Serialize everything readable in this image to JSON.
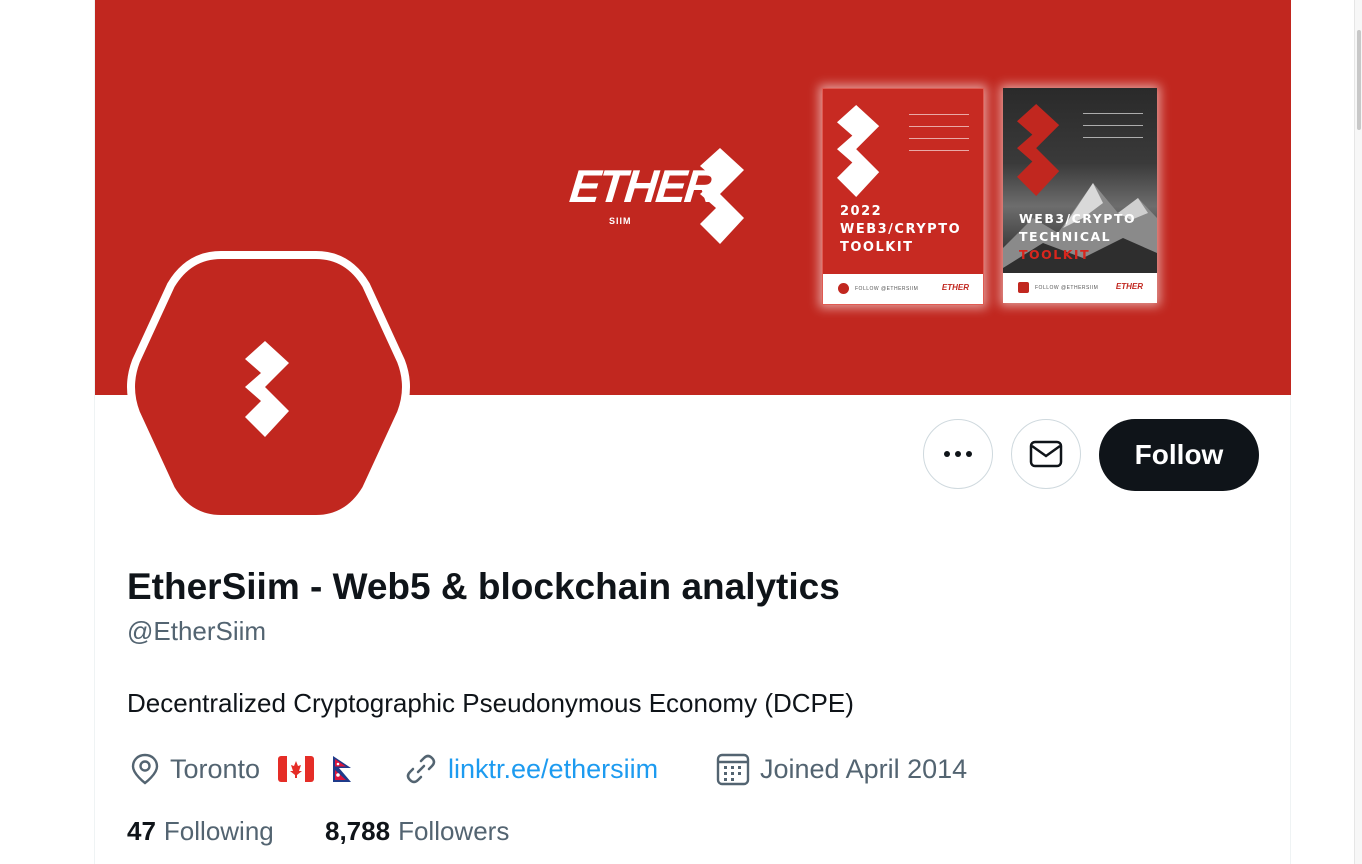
{
  "banner": {
    "brand_word": "ETHER",
    "brand_sub": "SIIM",
    "book1": {
      "title_lines": [
        "2022",
        "WEB3/CRYPTO",
        "TOOLKIT"
      ],
      "footer": "FOLLOW @ETHERSIIM",
      "footer_brand": "ETHER"
    },
    "book2": {
      "title_lines": [
        "WEB3/CRYPTO",
        "TECHNICAL"
      ],
      "title_accent": "TOOLKIT",
      "footer": "FOLLOW @ETHERSIIM",
      "footer_brand": "ETHER"
    }
  },
  "actions": {
    "more_icon": "ellipsis-icon",
    "message_icon": "envelope-icon",
    "follow_label": "Follow"
  },
  "profile": {
    "display_name": "EtherSiim - Web5 & blockchain analytics",
    "handle": "@EtherSiim",
    "bio": "Decentralized Cryptographic Pseudonymous Economy (DCPE)",
    "location": "Toronto",
    "flags": [
      "canada-flag",
      "nepal-flag"
    ],
    "website": "linktr.ee/ethersiim",
    "joined": "Joined April 2014"
  },
  "stats": {
    "following_count": "47",
    "following_label": "Following",
    "followers_count": "8,788",
    "followers_label": "Followers"
  },
  "colors": {
    "brand_red": "#c1271f",
    "link_blue": "#1d9bf0",
    "text_primary": "#0f1419",
    "text_secondary": "#536471"
  }
}
